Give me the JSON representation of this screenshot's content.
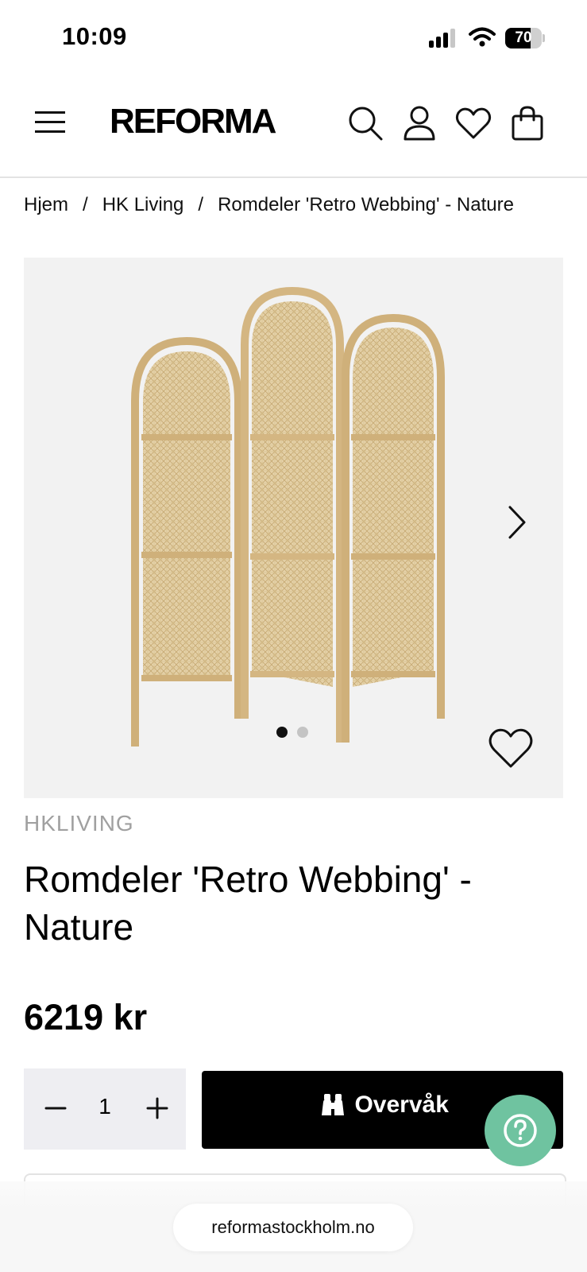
{
  "status_bar": {
    "time": "10:09",
    "battery_level": "70",
    "battery_fraction": 0.7,
    "icons": [
      "signal-icon",
      "wifi-icon",
      "battery-icon"
    ]
  },
  "header": {
    "logo": "REFORMA",
    "icons": [
      "menu-icon",
      "search-icon",
      "account-icon",
      "wishlist-icon",
      "cart-icon"
    ]
  },
  "breadcrumb": {
    "items": [
      "Hjem",
      "HK Living",
      "Romdeler 'Retro Webbing' - Nature"
    ],
    "separator": "/"
  },
  "gallery": {
    "image_subject": "rattan-room-divider",
    "slide_count": 2,
    "active_slide": 1,
    "icons": [
      "chevron-right-icon",
      "heart-icon"
    ]
  },
  "product": {
    "brand": "HKLIVING",
    "title": "Romdeler 'Retro Webbing' - Nature",
    "price": "6219 kr"
  },
  "purchase": {
    "quantity": "1",
    "watch_label": "Overvåk",
    "watch_icon": "binoculars-icon"
  },
  "help": {
    "icon": "question-icon",
    "color": "#6fc3a0"
  },
  "browser": {
    "url": "reformastockholm.no"
  },
  "colors": {
    "button_bg": "#000000",
    "gallery_bg": "#f2f2f2",
    "quantity_bg": "#eeeef2",
    "brand_text": "#a0a0a0"
  }
}
